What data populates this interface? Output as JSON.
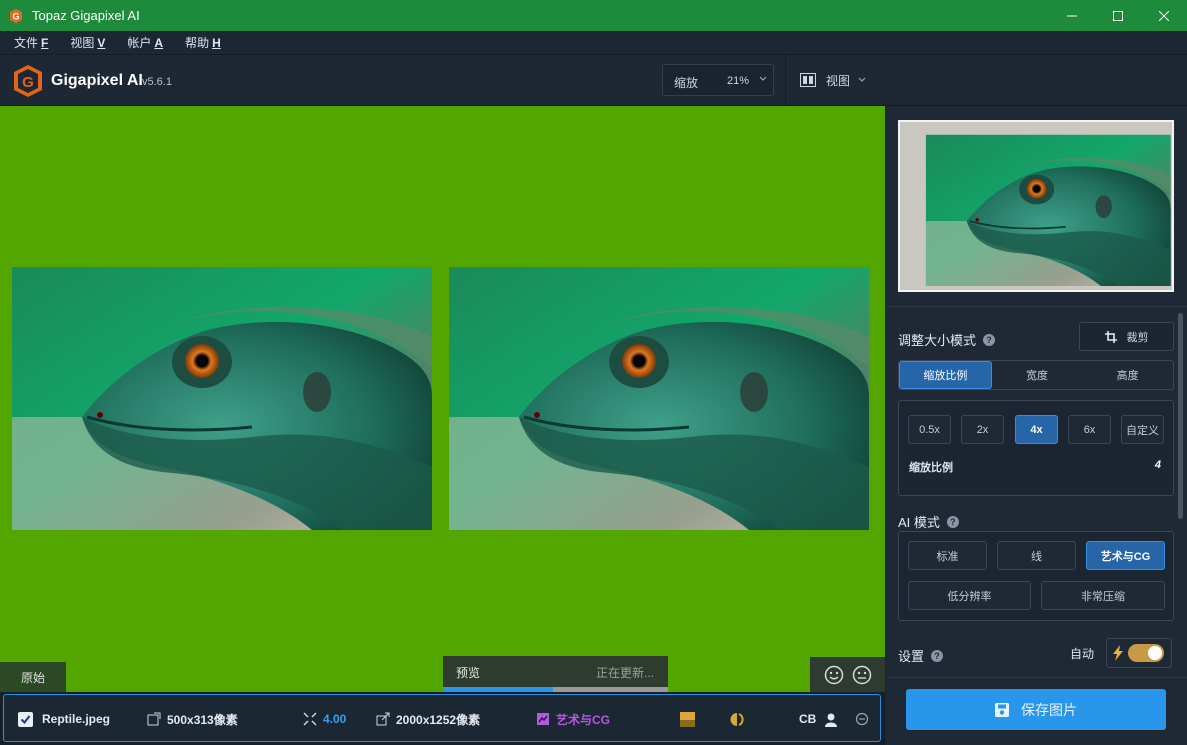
{
  "window": {
    "title": "Topaz Gigapixel AI",
    "controls": [
      "minimize-icon",
      "maximize-icon",
      "close-icon"
    ]
  },
  "menu": [
    {
      "label": "文件",
      "key": "F"
    },
    {
      "label": "视图",
      "key": "V"
    },
    {
      "label": "帐户",
      "key": "A"
    },
    {
      "label": "帮助",
      "key": "H"
    }
  ],
  "header": {
    "brand": "Gigapixel AI",
    "version": "v5.6.1",
    "zoom_label": "缩放",
    "zoom_value": "21%",
    "view_label": "视图"
  },
  "canvas": {
    "background": "#53a600",
    "original_label": "原始",
    "preview_label": "预览",
    "preview_status": "正在更新...",
    "preview_progress": 0.49
  },
  "filebar": {
    "checked": true,
    "filename": "Reptile.jpeg",
    "input_size": "500x313像素",
    "scale": "4.00",
    "output_size": "2000x1252像素",
    "model": "艺术与CG",
    "cb_label": "CB"
  },
  "rightpanel": {
    "resize_mode_title": "调整大小模式",
    "crop_label": "裁剪",
    "resize_tabs": [
      {
        "label": "缩放比例",
        "active": true
      },
      {
        "label": "宽度",
        "active": false
      },
      {
        "label": "高度",
        "active": false
      }
    ],
    "scale_options": [
      {
        "label": "0.5x",
        "active": false
      },
      {
        "label": "2x",
        "active": false
      },
      {
        "label": "4x",
        "active": true
      },
      {
        "label": "6x",
        "active": false
      },
      {
        "label": "自定义",
        "active": false
      }
    ],
    "scale_readout_label": "缩放比例",
    "scale_readout_value": "4",
    "ai_mode_title": "AI 模式",
    "ai_modes_row1": [
      {
        "label": "标准",
        "active": false
      },
      {
        "label": "线",
        "active": false
      },
      {
        "label": "艺术与CG",
        "active": true
      }
    ],
    "ai_modes_row2": [
      {
        "label": "低分辨率",
        "active": false
      },
      {
        "label": "非常压缩",
        "active": false
      }
    ],
    "settings_title": "设置",
    "auto_label": "自动",
    "auto_enabled": true,
    "save_label": "保存图片"
  },
  "colors": {
    "titlebar": "#1e8b3c",
    "accent": "#2a96ea",
    "active_chip": "#2565a8",
    "toggle": "#c89a48",
    "model_purple": "#b45adf"
  }
}
